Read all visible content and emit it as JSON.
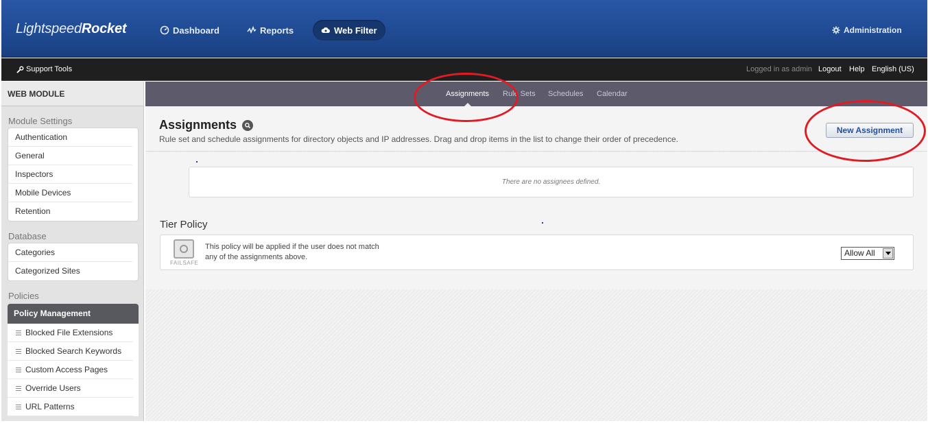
{
  "app": {
    "logo_light": "Lightspeed",
    "logo_bold": "Rocket",
    "nav": {
      "dashboard": "Dashboard",
      "reports": "Reports",
      "web_filter": "Web Filter",
      "administration": "Administration"
    },
    "colors": {
      "header": "#2a57a6",
      "accent_link": "#24509a",
      "annotation": "#e01b24"
    }
  },
  "subbar": {
    "support_tools": "Support Tools",
    "logged_in": "Logged in as admin",
    "logout": "Logout",
    "help": "Help",
    "language": "English (US)"
  },
  "sidebar": {
    "module_title": "WEB MODULE",
    "module_settings_label": "Module Settings",
    "module_settings": [
      "Authentication",
      "General",
      "Inspectors",
      "Mobile Devices",
      "Retention"
    ],
    "database_label": "Database",
    "database": [
      "Categories",
      "Categorized Sites"
    ],
    "policies_label": "Policies",
    "policy_management": "Policy Management",
    "policy_items": [
      "Blocked File Extensions",
      "Blocked Search Keywords",
      "Custom Access Pages",
      "Override Users",
      "URL Patterns"
    ]
  },
  "tabs": [
    "Assignments",
    "Rule Sets",
    "Schedules",
    "Calendar"
  ],
  "main": {
    "title": "Assignments",
    "description": "Rule set and schedule assignments for directory objects and IP addresses. Drag and drop items in the list to change their order of precedence.",
    "new_button": "New Assignment",
    "empty_text": "There are no assignees defined.",
    "tier_title": "Tier Policy",
    "failsafe_label": "FAILSAFE",
    "tier_desc_1": "This policy will be applied if the user does not match",
    "tier_desc_2": "any of the assignments above.",
    "tier_select_value": "Allow All"
  }
}
